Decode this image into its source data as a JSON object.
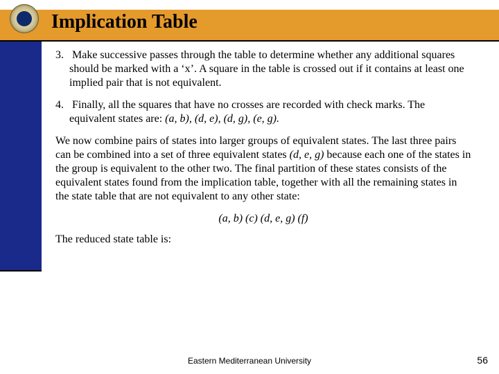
{
  "title": "Implication Table",
  "paragraphs": {
    "p3_num": "3.",
    "p3_text": "Make successive passes through the table to determine whether any additional squares should be marked with a ‘x’. A square in the table is crossed out if it contains at least one implied pair that is not equivalent.",
    "p4_num": "4.",
    "p4_lead": "Finally, all the squares that have no crosses are recorded with check marks. The equivalent states are: ",
    "p4_pairs": "(a, b), (d, e), (d, g), (e, g).",
    "p5_lead": "We now combine pairs of states into larger groups of equivalent states. The last three pairs can be combined into a set of three equivalent states ",
    "p5_set": "(d, e, g)",
    "p5_tail": " because each one of the states in the group is equivalent to the other two. The final partition of these states consists of the equivalent states found from the implication table, together with all the remaining states in the state table that are not equivalent to any other state:",
    "partition": "(a, b) (c) (d, e, g) (f)",
    "p6": "The reduced state table is:"
  },
  "footer": "Eastern Mediterranean University",
  "page_number": "56"
}
